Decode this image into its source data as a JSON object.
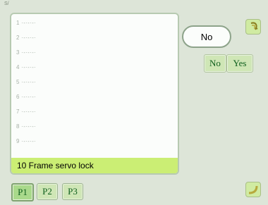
{
  "header": {
    "label": "S/"
  },
  "list": {
    "items": [
      "1 ·-·-·-·",
      "2 ·-·-·-·",
      "3 ·-·-·-·",
      "4 ·-·-·-·",
      "5 ·-·-·-·",
      "6 ·-·-·-·",
      "7 ·-·-·-·",
      "8 ·-·-·-·",
      "9 ·-·-·-·"
    ],
    "selected": "10 Frame servo lock"
  },
  "value": {
    "current": "No"
  },
  "options": {
    "no_label": "No",
    "yes_label": "Yes"
  },
  "pages": [
    {
      "label": "P1",
      "active": true
    },
    {
      "label": "P2",
      "active": false
    },
    {
      "label": "P3",
      "active": false
    }
  ],
  "icons": {
    "top_corner": "rotate-arrow-icon",
    "bottom_corner": "curved-return-arrow-icon"
  },
  "colors": {
    "selection": "#cbee74",
    "button": "#cfe6b6",
    "text_green": "#0f5f1d"
  }
}
